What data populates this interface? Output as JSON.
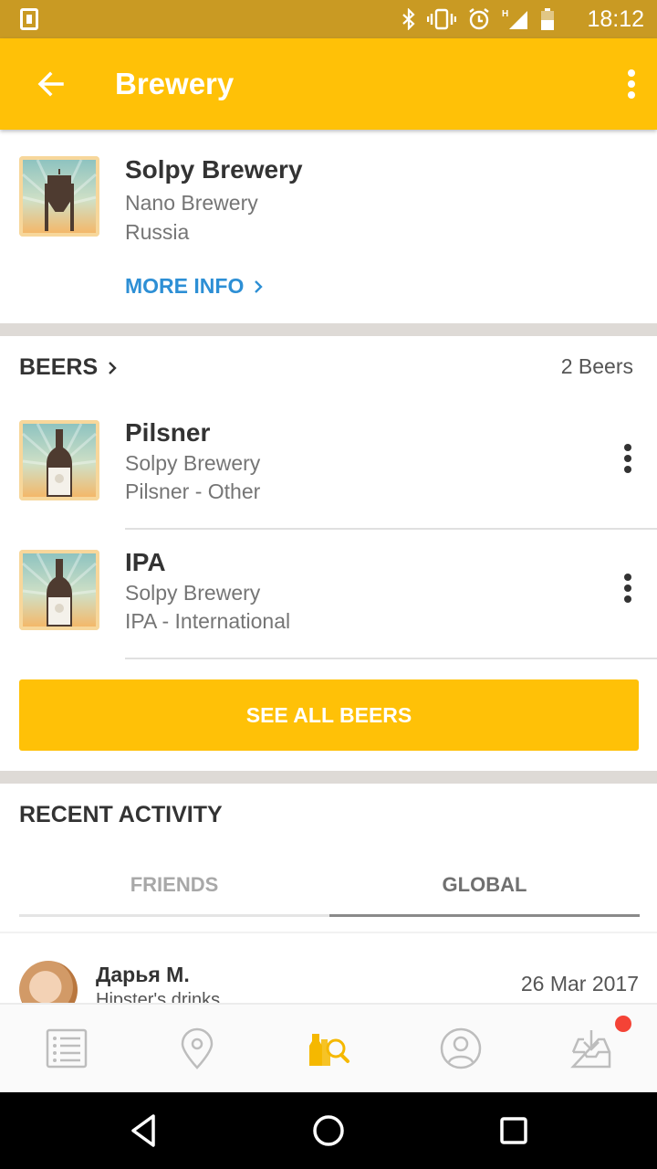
{
  "status_bar": {
    "time": "18:12",
    "network": "H"
  },
  "app_bar": {
    "title": "Brewery"
  },
  "brewery": {
    "name": "Solpy Brewery",
    "type": "Nano Brewery",
    "country": "Russia",
    "more_info_label": "MORE INFO"
  },
  "beers": {
    "header": "BEERS",
    "count": "2 Beers",
    "items": [
      {
        "name": "Pilsner",
        "brewery": "Solpy Brewery",
        "style": "Pilsner - Other"
      },
      {
        "name": "IPA",
        "brewery": "Solpy Brewery",
        "style": "IPA - International"
      }
    ],
    "see_all_label": "SEE ALL BEERS"
  },
  "recent_activity": {
    "heading": "RECENT ACTIVITY",
    "tabs": [
      "FRIENDS",
      "GLOBAL"
    ],
    "active_tab": "GLOBAL",
    "items": [
      {
        "user": "Дарья М.",
        "subtitle": "Hipster's drinks",
        "date": "26 Mar 2017"
      }
    ]
  },
  "bottom_nav": {
    "items": [
      "list-icon",
      "location-pin-icon",
      "beer-search-icon",
      "profile-icon",
      "inbox-icon"
    ],
    "active": "beer-search-icon",
    "inbox_badge": true
  },
  "colors": {
    "status_bar": "#c99a23",
    "accent": "#ffc107",
    "link": "#2d8fd5",
    "badge": "#f44336"
  }
}
